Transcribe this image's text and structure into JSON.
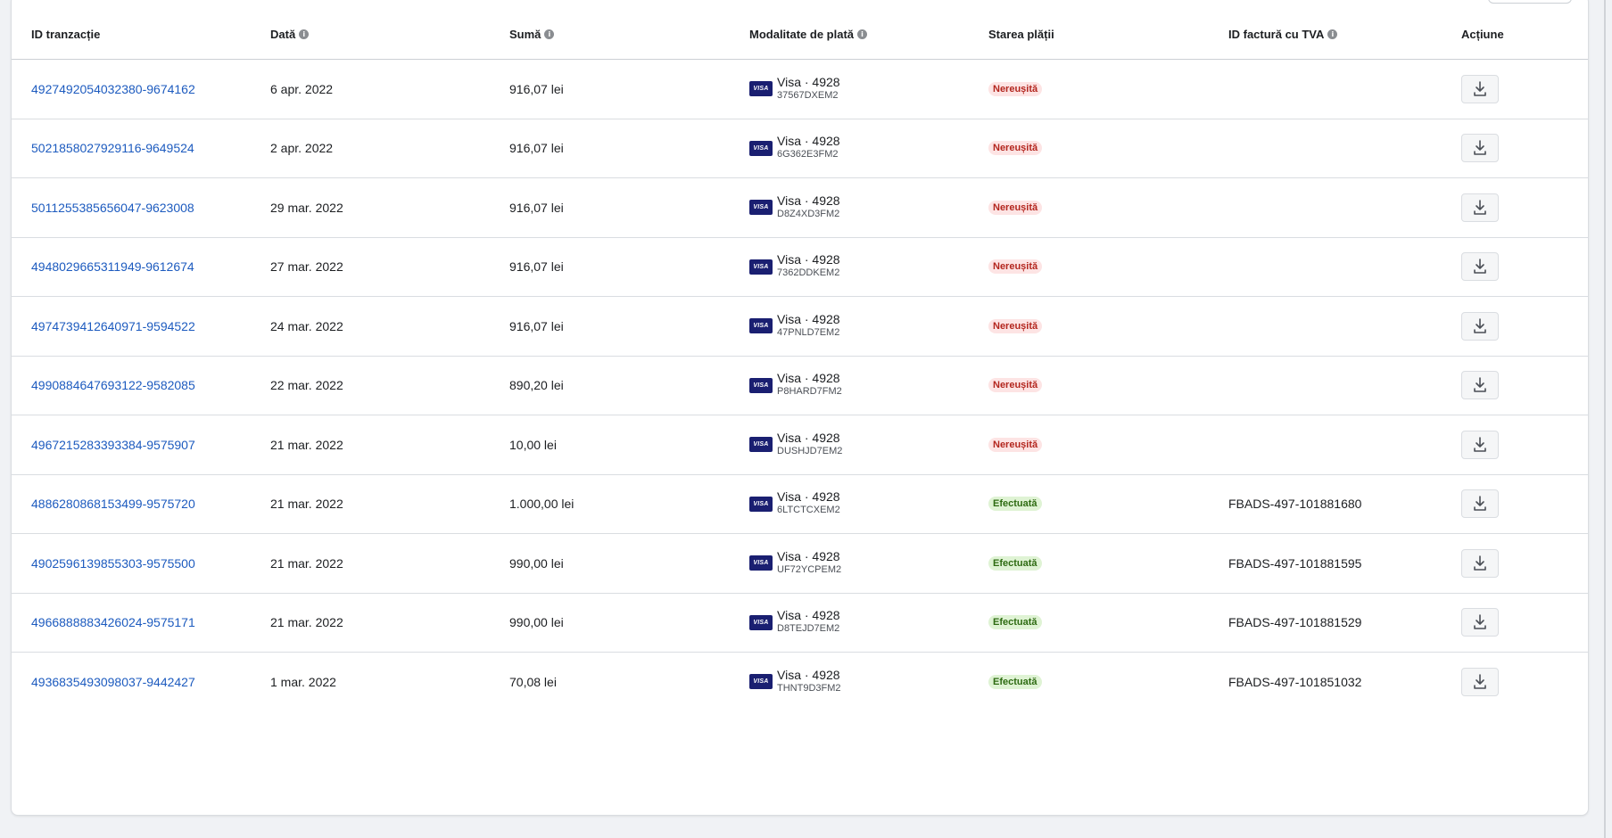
{
  "columns": [
    {
      "label": "ID tranzacție",
      "info": false
    },
    {
      "label": "Dată",
      "info": true
    },
    {
      "label": "Sumă",
      "info": true
    },
    {
      "label": "Modalitate de plată",
      "info": true
    },
    {
      "label": "Starea plății",
      "info": false
    },
    {
      "label": "ID factură cu TVA",
      "info": true
    },
    {
      "label": "Acțiune",
      "info": false
    }
  ],
  "card_brand": "VISA",
  "rows": [
    {
      "id": "4927492054032380-9674162",
      "date": "6 apr. 2022",
      "amount": "916,07 lei",
      "method": "Visa · 4928",
      "ref": "37567DXEM2",
      "status": "Nereușită",
      "status_type": "failed",
      "invoice": ""
    },
    {
      "id": "5021858027929116-9649524",
      "date": "2 apr. 2022",
      "amount": "916,07 lei",
      "method": "Visa · 4928",
      "ref": "6G362E3FM2",
      "status": "Nereușită",
      "status_type": "failed",
      "invoice": ""
    },
    {
      "id": "5011255385656047-9623008",
      "date": "29 mar. 2022",
      "amount": "916,07 lei",
      "method": "Visa · 4928",
      "ref": "D8Z4XD3FM2",
      "status": "Nereușită",
      "status_type": "failed",
      "invoice": ""
    },
    {
      "id": "4948029665311949-9612674",
      "date": "27 mar. 2022",
      "amount": "916,07 lei",
      "method": "Visa · 4928",
      "ref": "7362DDKEM2",
      "status": "Nereușită",
      "status_type": "failed",
      "invoice": ""
    },
    {
      "id": "4974739412640971-9594522",
      "date": "24 mar. 2022",
      "amount": "916,07 lei",
      "method": "Visa · 4928",
      "ref": "47PNLD7EM2",
      "status": "Nereușită",
      "status_type": "failed",
      "invoice": ""
    },
    {
      "id": "4990884647693122-9582085",
      "date": "22 mar. 2022",
      "amount": "890,20 lei",
      "method": "Visa · 4928",
      "ref": "P8HARD7FM2",
      "status": "Nereușită",
      "status_type": "failed",
      "invoice": ""
    },
    {
      "id": "4967215283393384-9575907",
      "date": "21 mar. 2022",
      "amount": "10,00 lei",
      "method": "Visa · 4928",
      "ref": "DUSHJD7EM2",
      "status": "Nereușită",
      "status_type": "failed",
      "invoice": ""
    },
    {
      "id": "4886280868153499-9575720",
      "date": "21 mar. 2022",
      "amount": "1.000,00 lei",
      "method": "Visa · 4928",
      "ref": "6LTCTCXEM2",
      "status": "Efectuată",
      "status_type": "ok",
      "invoice": "FBADS-497-101881680"
    },
    {
      "id": "4902596139855303-9575500",
      "date": "21 mar. 2022",
      "amount": "990,00 lei",
      "method": "Visa · 4928",
      "ref": "UF72YCPEM2",
      "status": "Efectuată",
      "status_type": "ok",
      "invoice": "FBADS-497-101881595"
    },
    {
      "id": "4966888883426024-9575171",
      "date": "21 mar. 2022",
      "amount": "990,00 lei",
      "method": "Visa · 4928",
      "ref": "D8TEJD7EM2",
      "status": "Efectuată",
      "status_type": "ok",
      "invoice": "FBADS-497-101881529"
    },
    {
      "id": "4936835493098037-9442427",
      "date": "1 mar. 2022",
      "amount": "70,08 lei",
      "method": "Visa · 4928",
      "ref": "THNT9D3FM2",
      "status": "Efectuată",
      "status_type": "ok",
      "invoice": "FBADS-497-101851032"
    }
  ]
}
